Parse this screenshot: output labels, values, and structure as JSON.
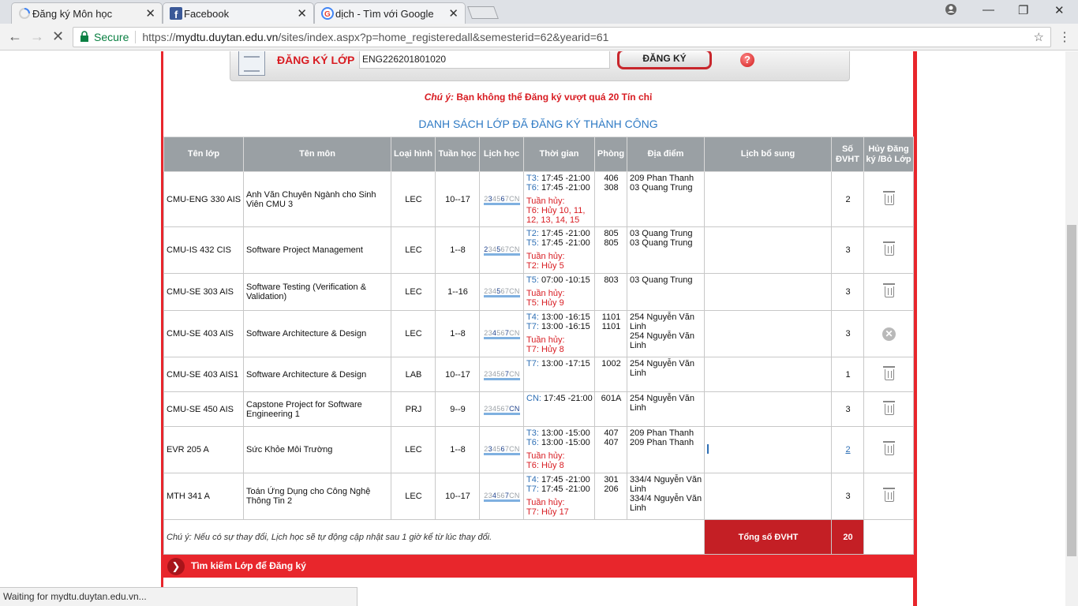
{
  "browser": {
    "tabs": [
      {
        "title": "Đăng ký Môn học",
        "icon": "loading-spinner-icon"
      },
      {
        "title": "Facebook",
        "icon": "facebook-icon"
      },
      {
        "title": "dịch - Tìm với Google",
        "icon": "google-icon"
      }
    ],
    "secure_label": "Secure",
    "url_prefix": "https://",
    "url_host": "mydtu.duytan.edu.vn",
    "url_path": "/sites/index.aspx?p=home_registeredall&semesterid=62&yearid=61",
    "status": "Waiting for mydtu.duytan.edu.vn..."
  },
  "register": {
    "label": "ĐĂNG KÝ LỚP",
    "input_value": "ENG226201801020",
    "button_label": "ĐĂNG KÝ",
    "help_icon": "?"
  },
  "warning": {
    "prefix": "Chú ý:",
    "text": " Bạn không thể Đăng ký vượt quá 20 Tín chỉ"
  },
  "list_title": "DANH SÁCH LỚP ĐÃ ĐĂNG KÝ THÀNH CÔNG",
  "table": {
    "headers": [
      "Tên lớp",
      "Tên môn",
      "Loại hình",
      "Tuần học",
      "Lịch học",
      "Thời gian",
      "Phòng",
      "Địa điểm",
      "Lịch bổ sung",
      "Số ĐVHT",
      "Hủy Đăng ký /Bỏ Lớp"
    ],
    "week_days": [
      "2",
      "3",
      "4",
      "5",
      "6",
      "7",
      "CN"
    ],
    "rows": [
      {
        "class": "CMU-ENG 330 AIS",
        "subject": "Anh Văn Chuyên Ngành cho Sinh Viên CMU 3",
        "type": "LEC",
        "weeks": "10--17",
        "times": [
          {
            "d": "T3:",
            "t": " 17:45 -21:00"
          },
          {
            "d": "T6:",
            "t": " 17:45 -21:00"
          }
        ],
        "cancel_label": "Tuần hủy:",
        "cancel": "T6: Hủy 10, 11, 12, 13, 14, 15",
        "rooms": [
          "406",
          "308"
        ],
        "locations": [
          "209 Phan Thanh",
          "03 Quang Trung"
        ],
        "credits": "2",
        "action": "trash-icon"
      },
      {
        "class": "CMU-IS 432 CIS",
        "subject": "Software Project Management",
        "type": "LEC",
        "weeks": "1--8",
        "times": [
          {
            "d": "T2:",
            "t": " 17:45 -21:00"
          },
          {
            "d": "T5:",
            "t": " 17:45 -21:00"
          }
        ],
        "cancel_label": "Tuần hủy:",
        "cancel": "T2: Hủy 5",
        "rooms": [
          "805",
          "805"
        ],
        "locations": [
          "03 Quang Trung",
          "03 Quang Trung"
        ],
        "credits": "3",
        "action": "trash-icon"
      },
      {
        "class": "CMU-SE 303 AIS",
        "subject": "Software Testing (Verification & Validation)",
        "type": "LEC",
        "weeks": "1--16",
        "times": [
          {
            "d": "T5:",
            "t": " 07:00 -10:15"
          }
        ],
        "cancel_label": "Tuần hủy:",
        "cancel": "T5: Hủy 9",
        "rooms": [
          "803"
        ],
        "locations": [
          "03 Quang Trung"
        ],
        "credits": "3",
        "action": "trash-icon"
      },
      {
        "class": "CMU-SE 403 AIS",
        "subject": "Software Architecture & Design",
        "type": "LEC",
        "weeks": "1--8",
        "times": [
          {
            "d": "T4:",
            "t": " 13:00 -16:15"
          },
          {
            "d": "T7:",
            "t": " 13:00 -16:15"
          }
        ],
        "cancel_label": "Tuần hủy:",
        "cancel": "T7: Hủy 8",
        "rooms": [
          "1101",
          "1101"
        ],
        "locations": [
          "254 Nguyễn Văn Linh",
          "254 Nguyễn Văn Linh"
        ],
        "credits": "3",
        "action": "x-circle-icon"
      },
      {
        "class": "CMU-SE 403 AIS1",
        "subject": "Software Architecture & Design",
        "type": "LAB",
        "weeks": "10--17",
        "times": [
          {
            "d": "T7:",
            "t": " 13:00 -17:15"
          }
        ],
        "cancel_label": "",
        "cancel": "",
        "rooms": [
          "1002"
        ],
        "locations": [
          "254 Nguyễn Văn Linh"
        ],
        "credits": "1",
        "action": "trash-icon"
      },
      {
        "class": "CMU-SE 450 AIS",
        "subject": "Capstone Project for Software Engineering 1",
        "type": "PRJ",
        "weeks": "9--9",
        "times": [
          {
            "d": "CN:",
            "t": " 17:45 -21:00"
          }
        ],
        "cancel_label": "",
        "cancel": "",
        "rooms": [
          "601A"
        ],
        "locations": [
          "254 Nguyễn Văn Linh"
        ],
        "credits": "3",
        "action": "trash-icon"
      },
      {
        "class": "EVR 205 A",
        "subject": "Sức Khỏe Môi Trường",
        "type": "LEC",
        "weeks": "1--8",
        "times": [
          {
            "d": "T3:",
            "t": " 13:00 -15:00"
          },
          {
            "d": "T6:",
            "t": " 13:00 -15:00"
          }
        ],
        "cancel_label": "Tuần hủy:",
        "cancel": "T6: Hủy 8",
        "rooms": [
          "407",
          "407"
        ],
        "locations": [
          "209 Phan Thanh",
          "209 Phan Thanh"
        ],
        "credits": "2",
        "action": "trash-icon"
      },
      {
        "class": "MTH 341 A",
        "subject": "Toán Ứng Dụng cho Công Nghệ Thông Tin 2",
        "type": "LEC",
        "weeks": "10--17",
        "times": [
          {
            "d": "T4:",
            "t": " 17:45 -21:00"
          },
          {
            "d": "T7:",
            "t": " 17:45 -21:00"
          }
        ],
        "cancel_label": "Tuần hủy:",
        "cancel": "T7: Hủy 17",
        "rooms": [
          "301",
          "206"
        ],
        "locations": [
          "334/4 Nguyễn Văn Linh",
          "334/4 Nguyễn Văn Linh"
        ],
        "credits": "3",
        "action": "trash-icon"
      }
    ],
    "footnote": "Chú ý: Nếu có sự thay đổi, Lịch học sẽ tự động cập nhật sau 1 giờ kể từ lúc thay đổi.",
    "total_label": "Tổng số ĐVHT",
    "total_value": "20"
  },
  "search_section": {
    "label": "Tìm kiếm Lớp để Đăng ký",
    "icon": "chevron-down-icon"
  }
}
